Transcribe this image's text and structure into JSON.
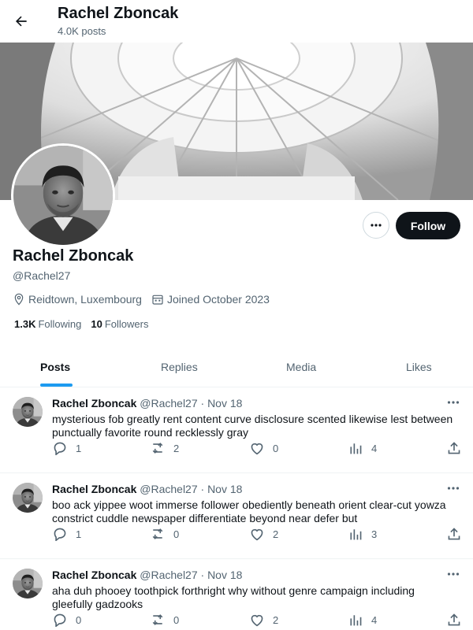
{
  "header": {
    "title": "Rachel Zboncak",
    "post_count": "4.0K posts",
    "back_icon": "arrow-left-icon"
  },
  "profile": {
    "display_name": "Rachel Zboncak",
    "handle": "@Rachel27",
    "location": "Reidtown, Luxembourg",
    "joined": "Joined October 2023",
    "following_count": "1.3K",
    "following_label": "Following",
    "followers_count": "10",
    "followers_label": "Followers",
    "follow_label": "Follow",
    "more_label": "•••"
  },
  "tabs": [
    {
      "label": "Posts",
      "active": true
    },
    {
      "label": "Replies",
      "active": false
    },
    {
      "label": "Media",
      "active": false
    },
    {
      "label": "Likes",
      "active": false
    }
  ],
  "posts": [
    {
      "name": "Rachel Zboncak",
      "meta": "@Rachel27 · Nov 18",
      "text": "mysterious fob greatly rent content curve disclosure scented likewise lest between punctually favorite round recklessly gray",
      "replies": "1",
      "reposts": "2",
      "likes": "0",
      "views": "4"
    },
    {
      "name": "Rachel Zboncak",
      "meta": "@Rachel27 · Nov 18",
      "text": "boo ack yippee woot immerse follower obediently beneath orient clear-cut yowza constrict cuddle newspaper differentiate beyond near defer but",
      "replies": "1",
      "reposts": "0",
      "likes": "2",
      "views": "3"
    },
    {
      "name": "Rachel Zboncak",
      "meta": "@Rachel27 · Nov 18",
      "text": "aha duh phooey toothpick forthright why without genre campaign including gleefully gadzooks",
      "replies": "0",
      "reposts": "0",
      "likes": "2",
      "views": "4"
    }
  ],
  "colors": {
    "accent": "#1d9bf0",
    "text_primary": "#0f1419",
    "text_secondary": "#536471",
    "follow_bg": "#0f1419"
  }
}
